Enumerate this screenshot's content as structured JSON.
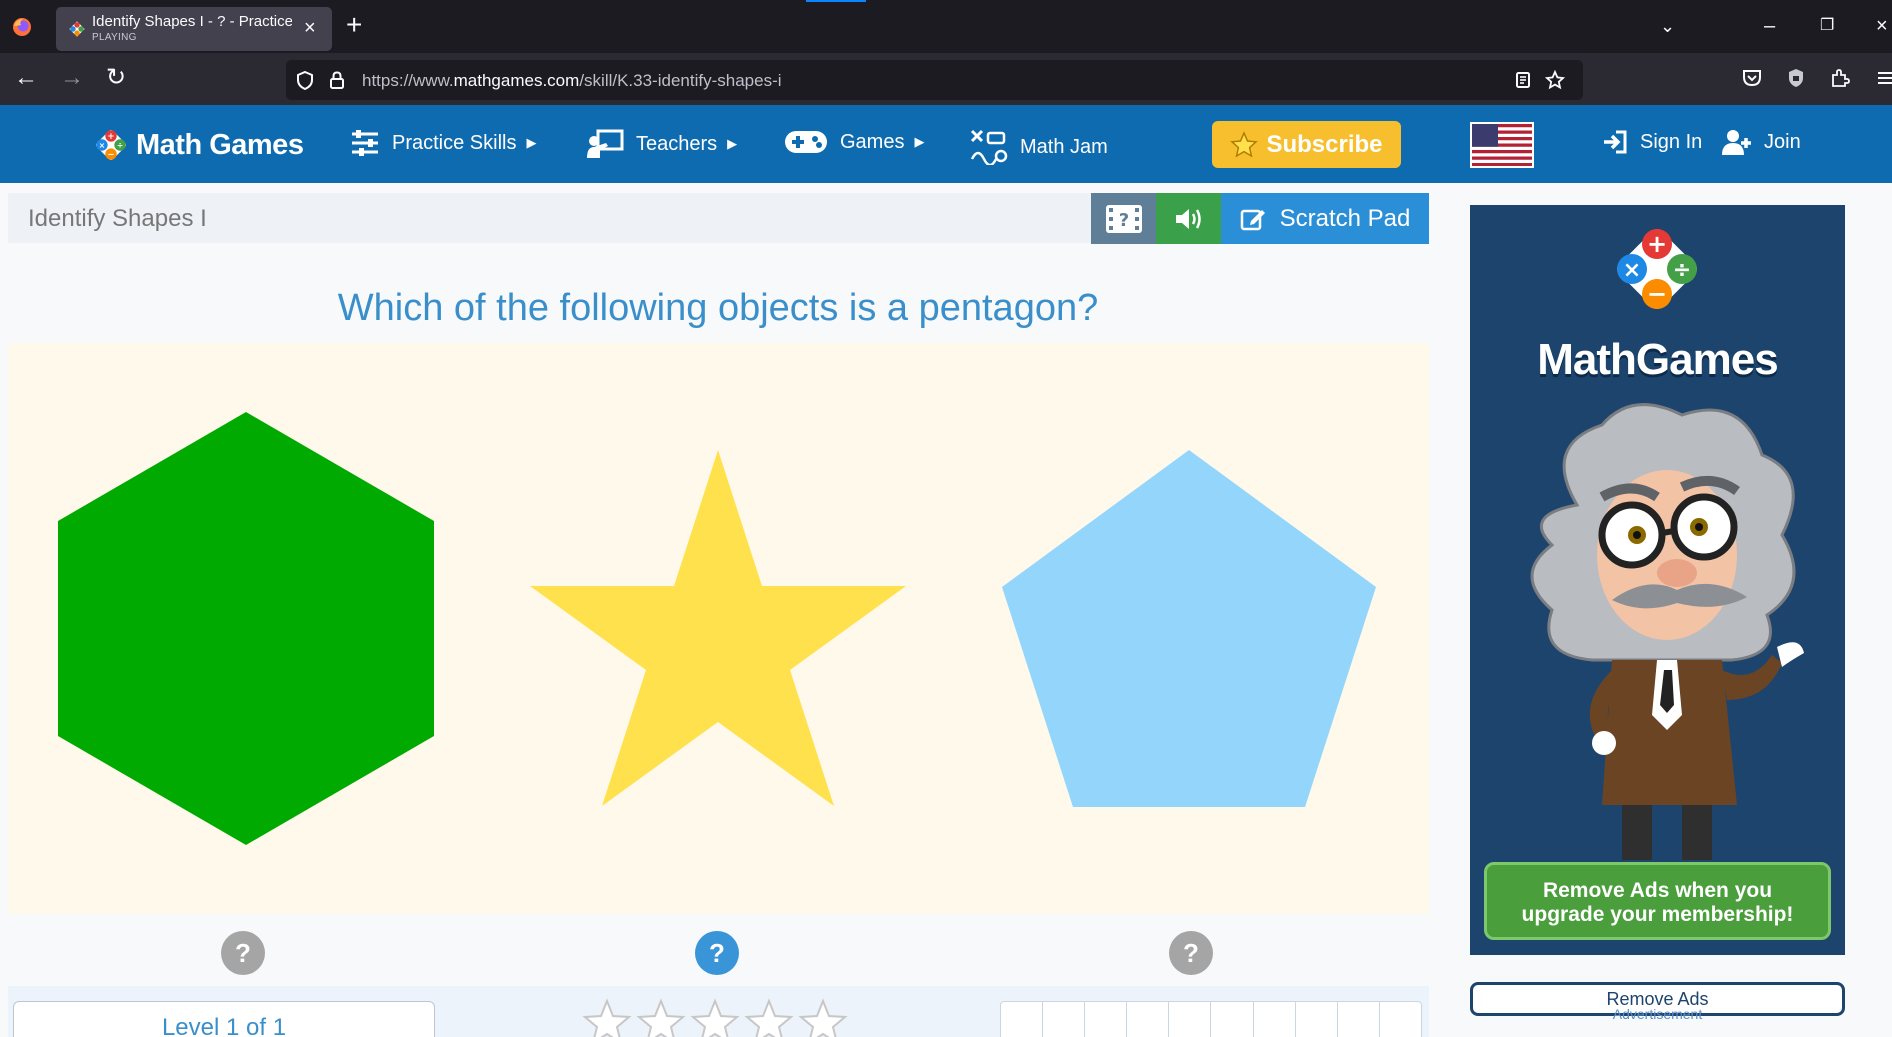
{
  "browser": {
    "tab_title": "Identify Shapes I - ? - Practice w",
    "tab_subtitle": "PLAYING",
    "url_prefix": "https://www.",
    "url_domain": "mathgames.com",
    "url_path": "/skill/K.33-identify-shapes-i"
  },
  "header": {
    "brand": "Math Games",
    "nav": [
      {
        "label": "Practice Skills",
        "icon": "sliders-icon"
      },
      {
        "label": "Teachers",
        "icon": "teacher-icon"
      },
      {
        "label": "Games",
        "icon": "gamepad-icon"
      },
      {
        "label": "Math Jam",
        "icon": "math-jam-icon"
      }
    ],
    "subscribe": "Subscribe",
    "sign_in": "Sign In",
    "join": "Join"
  },
  "skill": {
    "title": "Identify Shapes I",
    "scratch_pad": "Scratch Pad"
  },
  "question": {
    "text": "Which of the following objects is a pentagon?",
    "options": [
      {
        "shape": "hexagon",
        "color": "#00aa00"
      },
      {
        "shape": "star",
        "color": "#ffe14d"
      },
      {
        "shape": "pentagon",
        "color": "#93d5fb"
      }
    ],
    "hints": [
      "?",
      "?",
      "?"
    ]
  },
  "footer": {
    "level": "Level 1 of 1",
    "stars_total": 5,
    "stars_earned": 0,
    "progress_cells": 10
  },
  "ad": {
    "brand": "MathGames",
    "cta_line1": "Remove Ads when you",
    "cta_line2": "upgrade your membership!",
    "remove_ads": "Remove Ads",
    "label": "Advertisement"
  },
  "colors": {
    "header_blue": "#0f6bb0",
    "question_blue": "#3a8fcb",
    "subscribe_yellow": "#f7bf2e"
  }
}
